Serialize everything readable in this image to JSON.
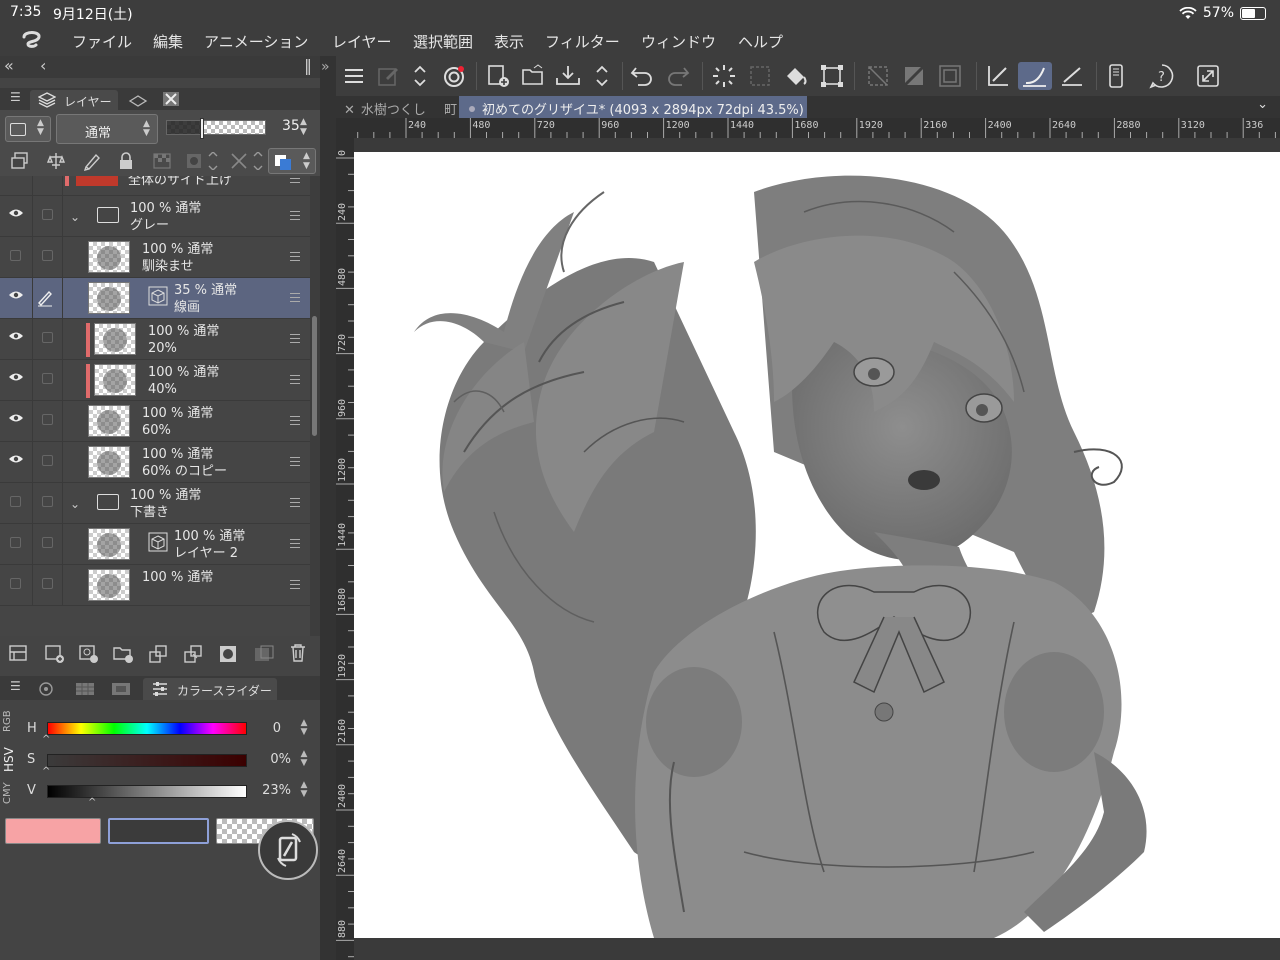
{
  "status": {
    "time": "7:35",
    "date": "9月12日(土)",
    "battery": "57%",
    "battery_level": 0.57
  },
  "menu": [
    "ファイル",
    "編集",
    "アニメーション",
    "レイヤー",
    "選択範囲",
    "表示",
    "フィルター",
    "ウィンドウ",
    "ヘルプ"
  ],
  "layer_panel": {
    "tab_label": "レイヤー",
    "blend_mode": "通常",
    "opacity": "35",
    "opacity_level": 0.35,
    "partial_layer_name": "全体のサイド上げ",
    "layers": [
      {
        "line1": "100 % 通常",
        "line2": "グレー",
        "type": "folder",
        "visible": true
      },
      {
        "line1": "100 % 通常",
        "line2": "馴染ませ",
        "type": "raster",
        "visible": false
      },
      {
        "line1": "35 % 通常",
        "line2": "線画",
        "type": "vector",
        "visible": true,
        "selected": true
      },
      {
        "line1": "100 % 通常",
        "line2": "20%",
        "type": "raster",
        "visible": true,
        "clip": true
      },
      {
        "line1": "100 % 通常",
        "line2": "40%",
        "type": "raster",
        "visible": true,
        "clip": true
      },
      {
        "line1": "100 % 通常",
        "line2": "60%",
        "type": "raster",
        "visible": true
      },
      {
        "line1": "100 % 通常",
        "line2": "60% のコピー",
        "type": "raster",
        "visible": true
      },
      {
        "line1": "100 % 通常",
        "line2": "下書き",
        "type": "folder",
        "visible": false
      },
      {
        "line1": "100 % 通常",
        "line2": "レイヤー 2",
        "type": "vector",
        "visible": false
      },
      {
        "line1": "100 % 通常",
        "line2": "",
        "type": "raster",
        "visible": false
      }
    ]
  },
  "color_panel": {
    "tab_label": "カラースライダー",
    "modes": [
      "RGB",
      "HSV",
      "CMY"
    ],
    "h_label": "H",
    "h_value": "0",
    "s_label": "S",
    "s_value": "0%",
    "v_label": "V",
    "v_value": "23%",
    "v_level": 0.23,
    "main_color": "#f7a3a5",
    "sub_color": "#3b3b3b"
  },
  "document": {
    "tab1": "水樹つくし",
    "tab1_suffix": "町",
    "tab2": "初めてのグリザイユ* (4093 x 2894px 72dpi 43.5%)"
  },
  "rulers": {
    "h": [
      "240",
      "480",
      "720",
      "960",
      "1200",
      "1440",
      "1680",
      "1920",
      "2160",
      "2400",
      "2640",
      "2880",
      "3120",
      "336"
    ],
    "v": [
      "0",
      "240",
      "480",
      "720",
      "960",
      "1200",
      "1440",
      "1680",
      "1920",
      "2160",
      "2400",
      "2640",
      "880"
    ]
  },
  "colors": {
    "accent": "#5d6a8a",
    "panel": "#444444",
    "canvas": "#ffffff"
  }
}
